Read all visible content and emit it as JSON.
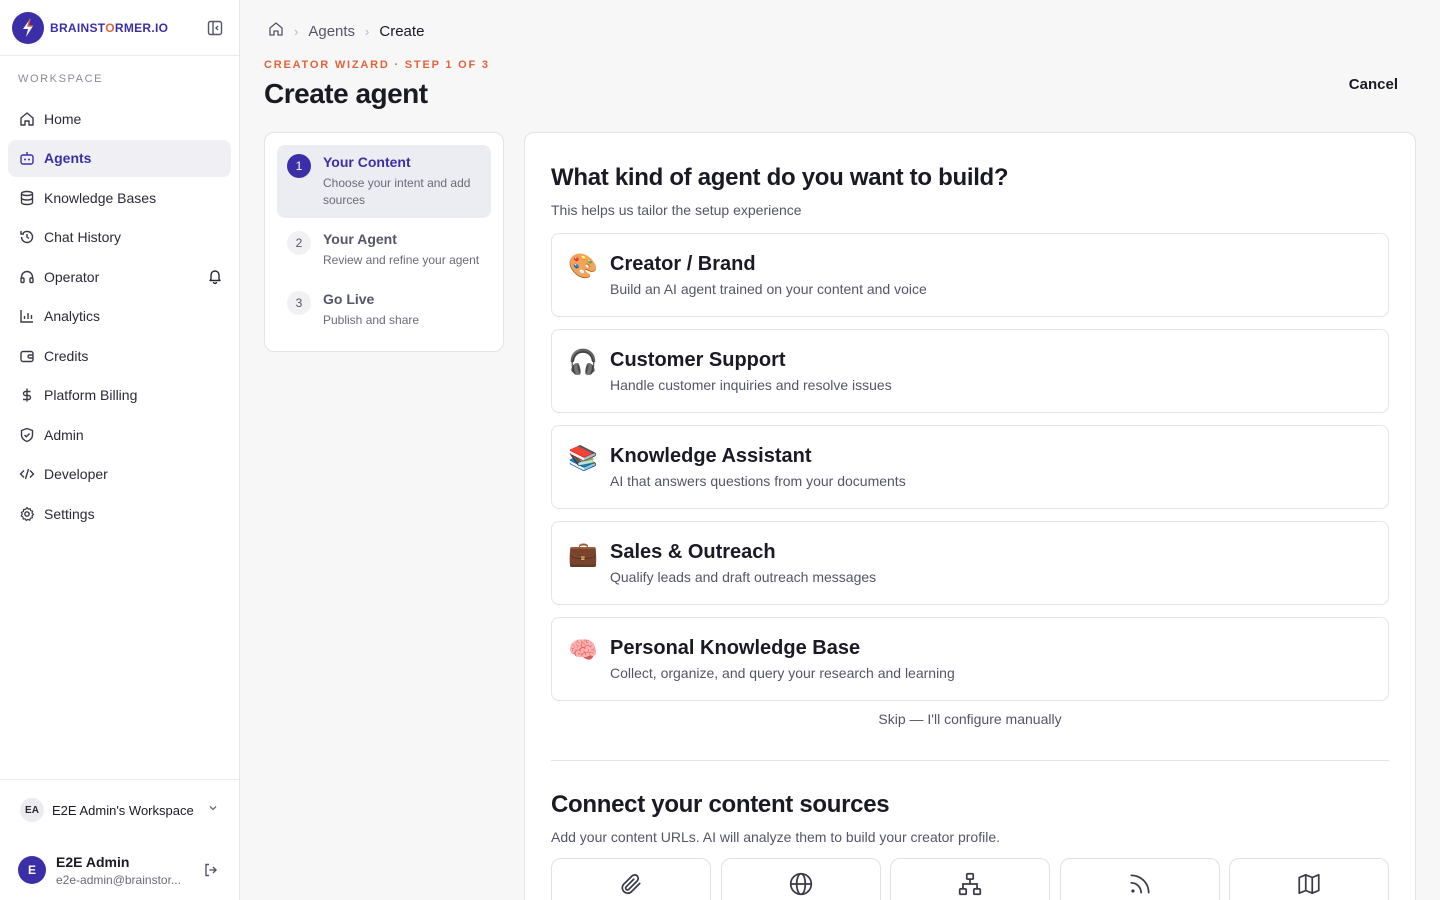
{
  "brand": {
    "name_pre": "BRAINST",
    "name_accent": "O",
    "name_post": "RMER.IO",
    "accent_color": "#3b2fa8",
    "highlight_color": "#e2633a"
  },
  "sidebar": {
    "section_label": "WORKSPACE",
    "items": [
      {
        "label": "Home",
        "icon": "home-icon"
      },
      {
        "label": "Agents",
        "icon": "bot-icon"
      },
      {
        "label": "Knowledge Bases",
        "icon": "database-icon"
      },
      {
        "label": "Chat History",
        "icon": "history-icon"
      },
      {
        "label": "Operator",
        "icon": "headset-icon"
      },
      {
        "label": "Analytics",
        "icon": "bar-chart-icon"
      },
      {
        "label": "Credits",
        "icon": "wallet-icon"
      },
      {
        "label": "Platform Billing",
        "icon": "dollar-icon"
      },
      {
        "label": "Admin",
        "icon": "shield-icon"
      },
      {
        "label": "Developer",
        "icon": "code-icon"
      },
      {
        "label": "Settings",
        "icon": "gear-icon"
      }
    ],
    "active_index": 1,
    "workspace": {
      "badge": "EA",
      "name": "E2E Admin's Workspace"
    },
    "user": {
      "initial": "E",
      "name": "E2E Admin",
      "email": "e2e-admin@brainstor..."
    }
  },
  "breadcrumb": {
    "items": [
      "Agents",
      "Create"
    ]
  },
  "header": {
    "eyebrow": "CREATOR WIZARD · STEP 1 OF 3",
    "title": "Create agent",
    "cancel_label": "Cancel"
  },
  "steps": [
    {
      "num": "1",
      "title": "Your Content",
      "sub": "Choose your intent and add sources"
    },
    {
      "num": "2",
      "title": "Your Agent",
      "sub": "Review and refine your agent"
    },
    {
      "num": "3",
      "title": "Go Live",
      "sub": "Publish and share"
    }
  ],
  "intent": {
    "title": "What kind of agent do you want to build?",
    "subtitle": "This helps us tailor the setup experience",
    "options": [
      {
        "emoji": "🎨",
        "title": "Creator / Brand",
        "desc": "Build an AI agent trained on your content and voice"
      },
      {
        "emoji": "🎧",
        "title": "Customer Support",
        "desc": "Handle customer inquiries and resolve issues"
      },
      {
        "emoji": "📚",
        "title": "Knowledge Assistant",
        "desc": "AI that answers questions from your documents"
      },
      {
        "emoji": "💼",
        "title": "Sales & Outreach",
        "desc": "Qualify leads and draft outreach messages"
      },
      {
        "emoji": "🧠",
        "title": "Personal Knowledge Base",
        "desc": "Collect, organize, and query your research and learning"
      }
    ],
    "skip_label": "Skip — I'll configure manually"
  },
  "sources": {
    "title": "Connect your content sources",
    "subtitle": "Add your content URLs. AI will analyze them to build your creator profile.",
    "tiles": [
      "paperclip-icon",
      "globe-icon",
      "sitemap-icon",
      "rss-icon",
      "map-icon"
    ]
  }
}
